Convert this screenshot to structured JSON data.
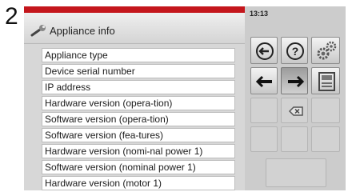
{
  "step_number": "2",
  "header": {
    "title": "Appliance info",
    "icon": "wrench-icon",
    "accent_color": "#c4161c"
  },
  "items": [
    {
      "label": "Appliance type"
    },
    {
      "label": "Device serial number"
    },
    {
      "label": "IP address"
    },
    {
      "label": "Hardware version (opera-tion)"
    },
    {
      "label": "Software version (opera-tion)"
    },
    {
      "label": "Software version (fea-tures)"
    },
    {
      "label": "Hardware version (nomi-nal power 1)"
    },
    {
      "label": "Software version (nominal power 1)"
    },
    {
      "label": "Hardware version (motor 1)"
    }
  ],
  "status_bar": {
    "time": "13:13"
  },
  "keypad": {
    "back": "back-icon",
    "help": "help-icon",
    "settings": "settings-gears-icon",
    "left": "arrow-left-icon",
    "right": "arrow-right-icon",
    "save": "save-icon",
    "backspace": "backspace-icon"
  }
}
